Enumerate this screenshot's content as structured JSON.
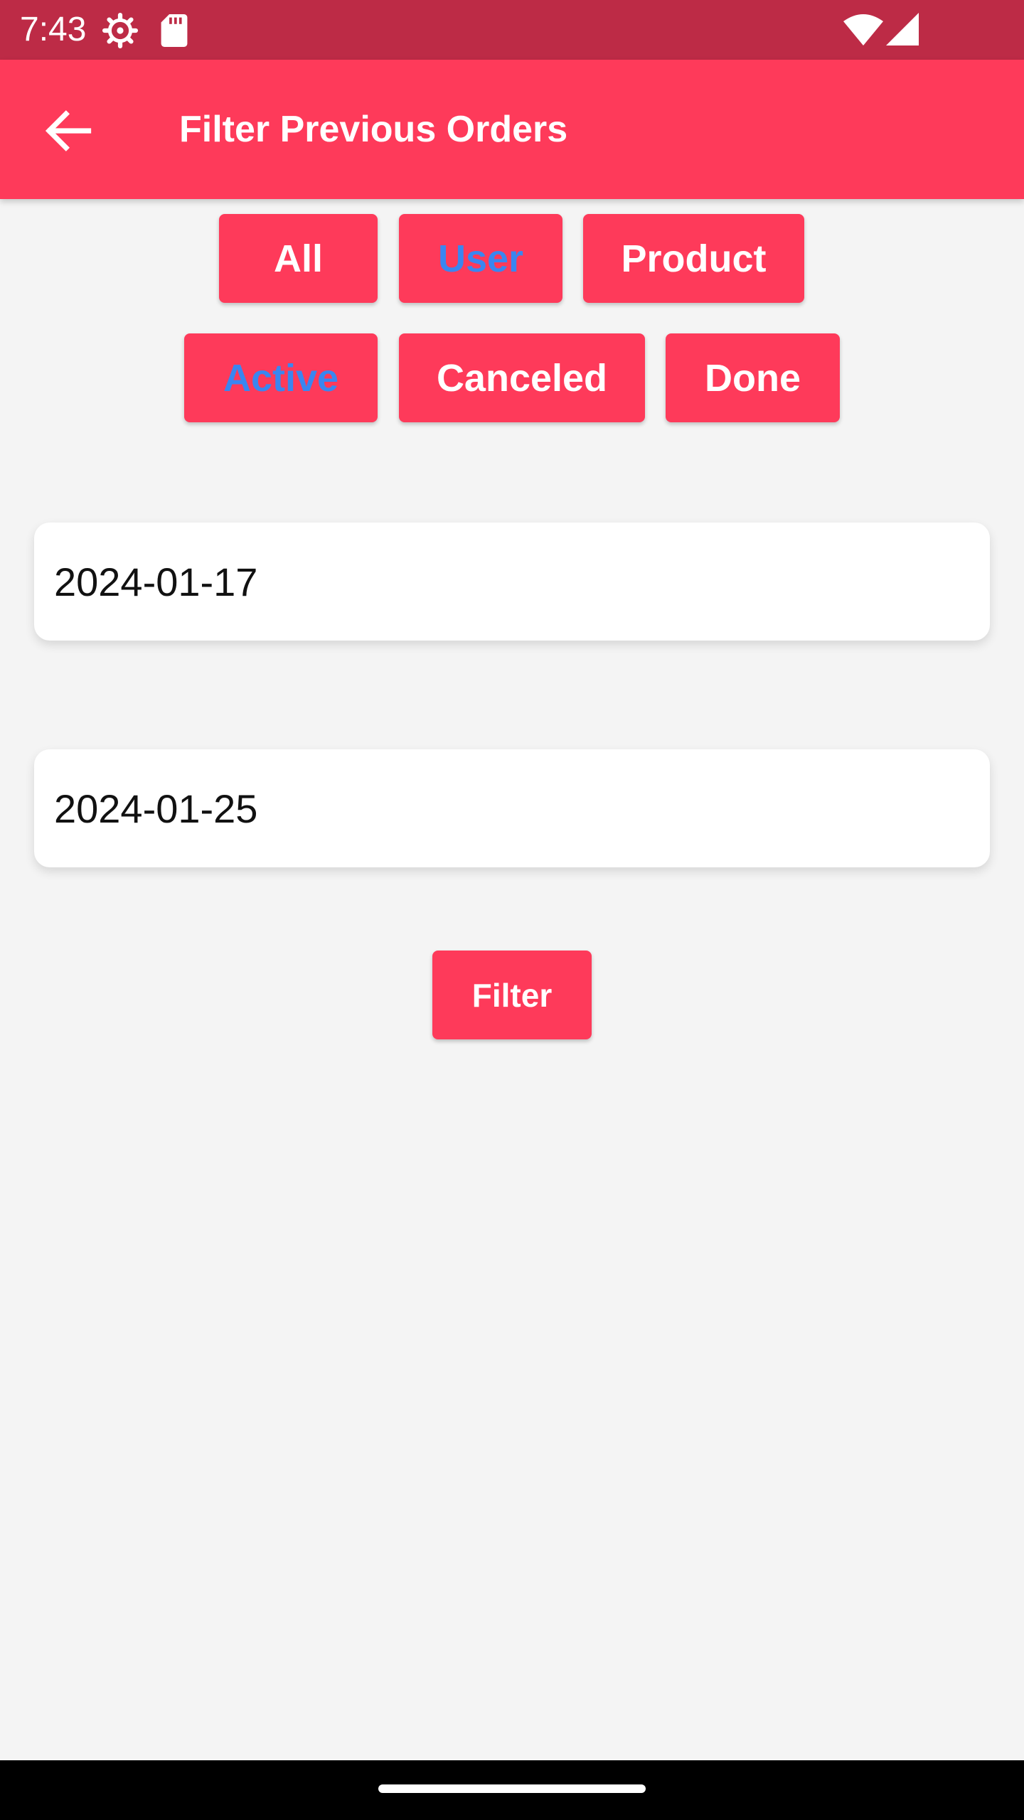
{
  "status_bar": {
    "time": "7:43",
    "icons": [
      "settings-gear-icon",
      "sd-card-icon",
      "wifi-icon",
      "cellular-signal-icon"
    ],
    "background_color": "#bd2b46"
  },
  "app_bar": {
    "title": "Filter Previous Orders",
    "back_icon": "arrow-back-icon",
    "background_color": "#fe3a5a"
  },
  "filters": {
    "type_options": [
      {
        "label": "All",
        "selected": false
      },
      {
        "label": "User",
        "selected": true
      },
      {
        "label": "Product",
        "selected": false
      }
    ],
    "status_options": [
      {
        "label": "Active",
        "selected": true
      },
      {
        "label": "Canceled",
        "selected": false
      },
      {
        "label": "Done",
        "selected": false
      }
    ],
    "selected_text_color": "#3a86f0"
  },
  "dates": {
    "start": "2024-01-17",
    "end": "2024-01-25"
  },
  "filter_button": {
    "label": "Filter"
  }
}
